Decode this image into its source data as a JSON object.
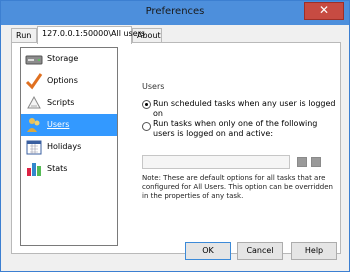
{
  "window": {
    "title": "Preferences",
    "close_glyph": "✕"
  },
  "tabs": [
    {
      "label": "Run"
    },
    {
      "label": "127.0.0.1:50000\\All users"
    },
    {
      "label": "About"
    }
  ],
  "sidebar": {
    "items": [
      {
        "label": "Storage",
        "icon": "storage-icon"
      },
      {
        "label": "Options",
        "icon": "checkmark-icon"
      },
      {
        "label": "Scripts",
        "icon": "scripts-icon"
      },
      {
        "label": "Users",
        "icon": "users-icon"
      },
      {
        "label": "Holidays",
        "icon": "calendar-icon"
      },
      {
        "label": "Stats",
        "icon": "bar-chart-icon"
      }
    ],
    "selected": "Users"
  },
  "users_group": {
    "label": "Users",
    "option_any": "Run scheduled tasks when any user is logged on",
    "option_specific_line1": "Run tasks when only one of the following",
    "option_specific_line2": "users is logged on and active:",
    "note": "Note: These are default options for all tasks that are configured for All Users. This option can be overridden in the properties of any task."
  },
  "buttons": {
    "ok": "OK",
    "cancel": "Cancel",
    "help": "Help"
  },
  "colors": {
    "titlebar": "#4d8fdc",
    "selection": "#3399ff",
    "close": "#c74b42"
  }
}
